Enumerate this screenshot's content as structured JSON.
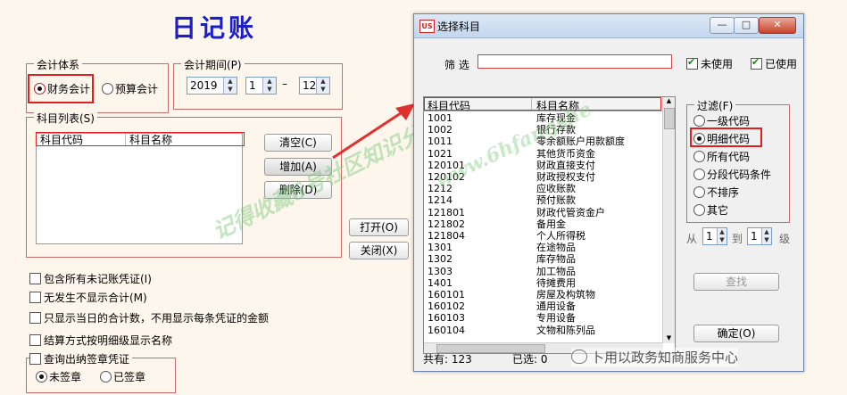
{
  "page": {
    "title": "日记账"
  },
  "accounting_system": {
    "legend": "会计体系",
    "options": [
      "财务会计",
      "预算会计"
    ],
    "selected": "财务会计"
  },
  "period": {
    "legend": "会计期间(P)",
    "year": "2019",
    "from_month": "1",
    "separator": "–",
    "to_month": "12"
  },
  "subject_list": {
    "legend": "科目列表(S)",
    "col_code": "科目代码",
    "col_name": "科目名称",
    "btn_clear": "清空(C)",
    "btn_add": "增加(A)",
    "btn_delete": "删除(D)"
  },
  "main_buttons": {
    "print": "打开(O)",
    "close": "关闭(X)"
  },
  "checkboxes": [
    "包含所有未记账凭证(I)",
    "无发生不显示合计(M)",
    "只显示当日的合计数，不用显示每条凭证的金额",
    "结算方式按明细级显示名称",
    "查询出纳签章凭证"
  ],
  "sign_status": {
    "options": [
      "未签章",
      "已签章"
    ],
    "selected": "未签章"
  },
  "dialog": {
    "logo": "US",
    "title": "选择科目",
    "win_buttons": [
      "—",
      "□",
      "✕"
    ],
    "filter_label": "筛 选",
    "filter_value": "",
    "unused_label": "未使用",
    "used_label": "已使用",
    "col_code": "科目代码",
    "col_name": "科目名称",
    "rows": [
      {
        "code": "1001",
        "name": "库存现金"
      },
      {
        "code": "1002",
        "name": "银行存款"
      },
      {
        "code": "1011",
        "name": "零余额账户用款额度"
      },
      {
        "code": "1021",
        "name": "其他货币资金"
      },
      {
        "code": "120101",
        "name": "财政直接支付"
      },
      {
        "code": "120102",
        "name": "财政授权支付"
      },
      {
        "code": "1212",
        "name": "应收账款"
      },
      {
        "code": "1214",
        "name": "预付账款"
      },
      {
        "code": "121801",
        "name": "财政代管资金户"
      },
      {
        "code": "121802",
        "name": "备用金"
      },
      {
        "code": "121804",
        "name": "个人所得税"
      },
      {
        "code": "1301",
        "name": "在途物品"
      },
      {
        "code": "1302",
        "name": "库存物品"
      },
      {
        "code": "1303",
        "name": "加工物品"
      },
      {
        "code": "1401",
        "name": "待摊费用"
      },
      {
        "code": "160101",
        "name": "房屋及构筑物"
      },
      {
        "code": "160102",
        "name": "通用设备"
      },
      {
        "code": "160103",
        "name": "专用设备"
      },
      {
        "code": "160104",
        "name": "文物和陈列品"
      }
    ],
    "status_total": "共有: 123",
    "status_selected": "已选: 0",
    "filter_group": {
      "legend": "过滤(F)",
      "options": [
        "一级代码",
        "明细代码",
        "所有代码",
        "分段代码条件",
        "不排序",
        "其它"
      ],
      "selected": "明细代码"
    },
    "range_from_label": "从",
    "range_from": "1",
    "range_to_label": "到",
    "range_to": "1",
    "range_unit": "级",
    "btn_search": "查找",
    "btn_ok": "确定(O)"
  },
  "watermarks": [
    "记得收藏6号社区知识分享",
    "www.6hfangshe"
  ],
  "footer_watermark": "卜用以政务知商服务中心",
  "colors": {
    "title": "#1a1fc8",
    "highlight": "#e02020",
    "group_border": "#c86a6a"
  }
}
